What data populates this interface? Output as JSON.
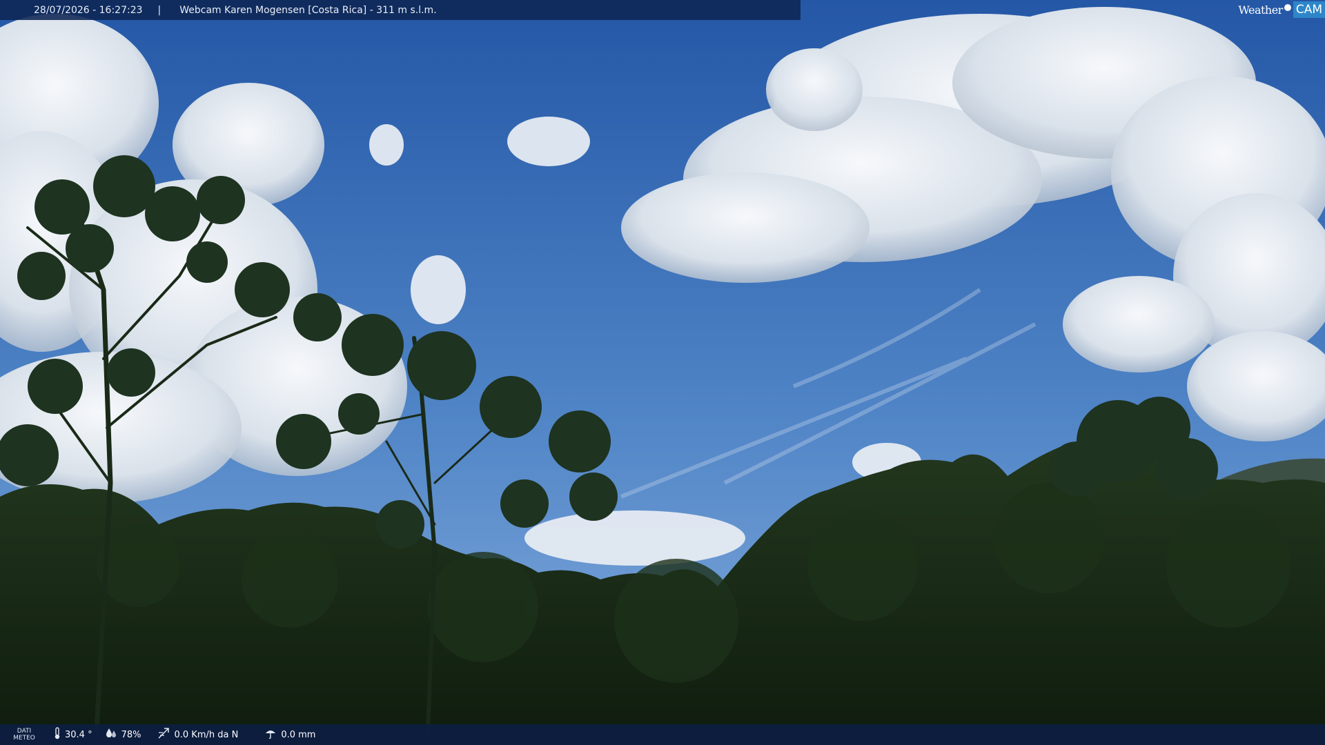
{
  "header": {
    "timestamp": "28/07/2026 - 16:27:23",
    "separator": "|",
    "title": "Webcam Karen Mogensen [Costa Rica]  - 311 m s.l.m."
  },
  "brand": {
    "weather_text": "Weather",
    "cam_text": "CAM"
  },
  "footer": {
    "label_line1": "DATI",
    "label_line2": "METEO",
    "temperature": "30.4 °",
    "humidity": "78%",
    "wind": "0.0 Km/h da N",
    "rain": "0.0 mm"
  },
  "icons": {
    "temperature": "thermometer-icon",
    "humidity": "humidity-icon",
    "wind": "wind-icon",
    "rain": "rain-icon"
  },
  "colors": {
    "sky_top": "#245aa8",
    "sky_bottom": "#6f9fd6",
    "cloud": "#e8edf3",
    "forest": "#172815",
    "bar": "#0e2654",
    "brand_accent": "#2e86c9"
  }
}
